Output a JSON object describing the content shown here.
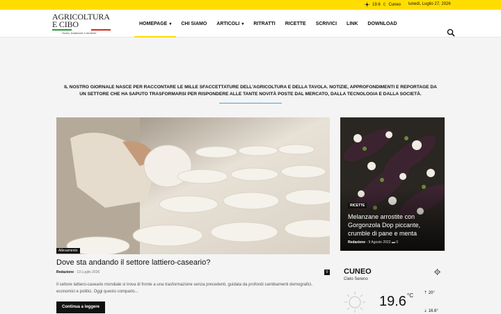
{
  "topbar": {
    "temp": "19.6",
    "unit": "C",
    "city": "Cuneo",
    "date": "lunedì, Luglio 27, 2026"
  },
  "logo": {
    "line1": "AGRICOLTURA",
    "line2": "E CIBO",
    "tagline": "Gusto, tradizione e territorio"
  },
  "nav": {
    "items": [
      {
        "label": "HOMEPAGE",
        "dropdown": true,
        "active": true
      },
      {
        "label": "CHI SIAMO"
      },
      {
        "label": "ARTICOLI",
        "dropdown": true
      },
      {
        "label": "RITRATTI"
      },
      {
        "label": "RICETTE"
      },
      {
        "label": "SCRIVICI"
      },
      {
        "label": "LINK"
      },
      {
        "label": "DOWNLOAD"
      }
    ]
  },
  "intro": "IL NOSTRO GIORNALE NASCE PER RACCONTARE LE MILLE SFACCETTATURE DELL'AGRICOLTURA E DELLA TAVOLA. NOTIZIE, APPROFONDIMENTI E REPORTAGE DA UN SETTORE CHE HA SAPUTO TRASFORMARSI PER RISPONDERE ALLE TANTE NOVITÀ POSTE DAL MERCATO, DALLA TECNOLOGIA E DALLA SOCIETÀ.",
  "main_article": {
    "category": "Allevamento",
    "title": "Dove sta andando il settore lattiero-caseario?",
    "author": "Redazione",
    "date": "13 Luglio 2026",
    "comments": "0",
    "excerpt": "Il settore lattiero-caseario mondiale si trova di fronte a una trasformazione senza precedenti, guidata da profondi cambiamenti demografici, economici e politici. Oggi questo comparto...",
    "button": "Continua a leggere"
  },
  "side_article": {
    "category": "RICETTE",
    "title": "Melanzane arrostite con Gorgonzola Dop piccante, crumble di pane e menta",
    "author": "Redazione",
    "date": "9 Agosto 2022",
    "comments": "0"
  },
  "weather": {
    "city": "CUNEO",
    "desc": "Cielo Sereno",
    "temp": "19.6",
    "unit": "°C",
    "hi": "20°",
    "lo": "16.6°"
  },
  "colors": {
    "accent": "#ffdd00",
    "line": "#4aa4d6"
  }
}
